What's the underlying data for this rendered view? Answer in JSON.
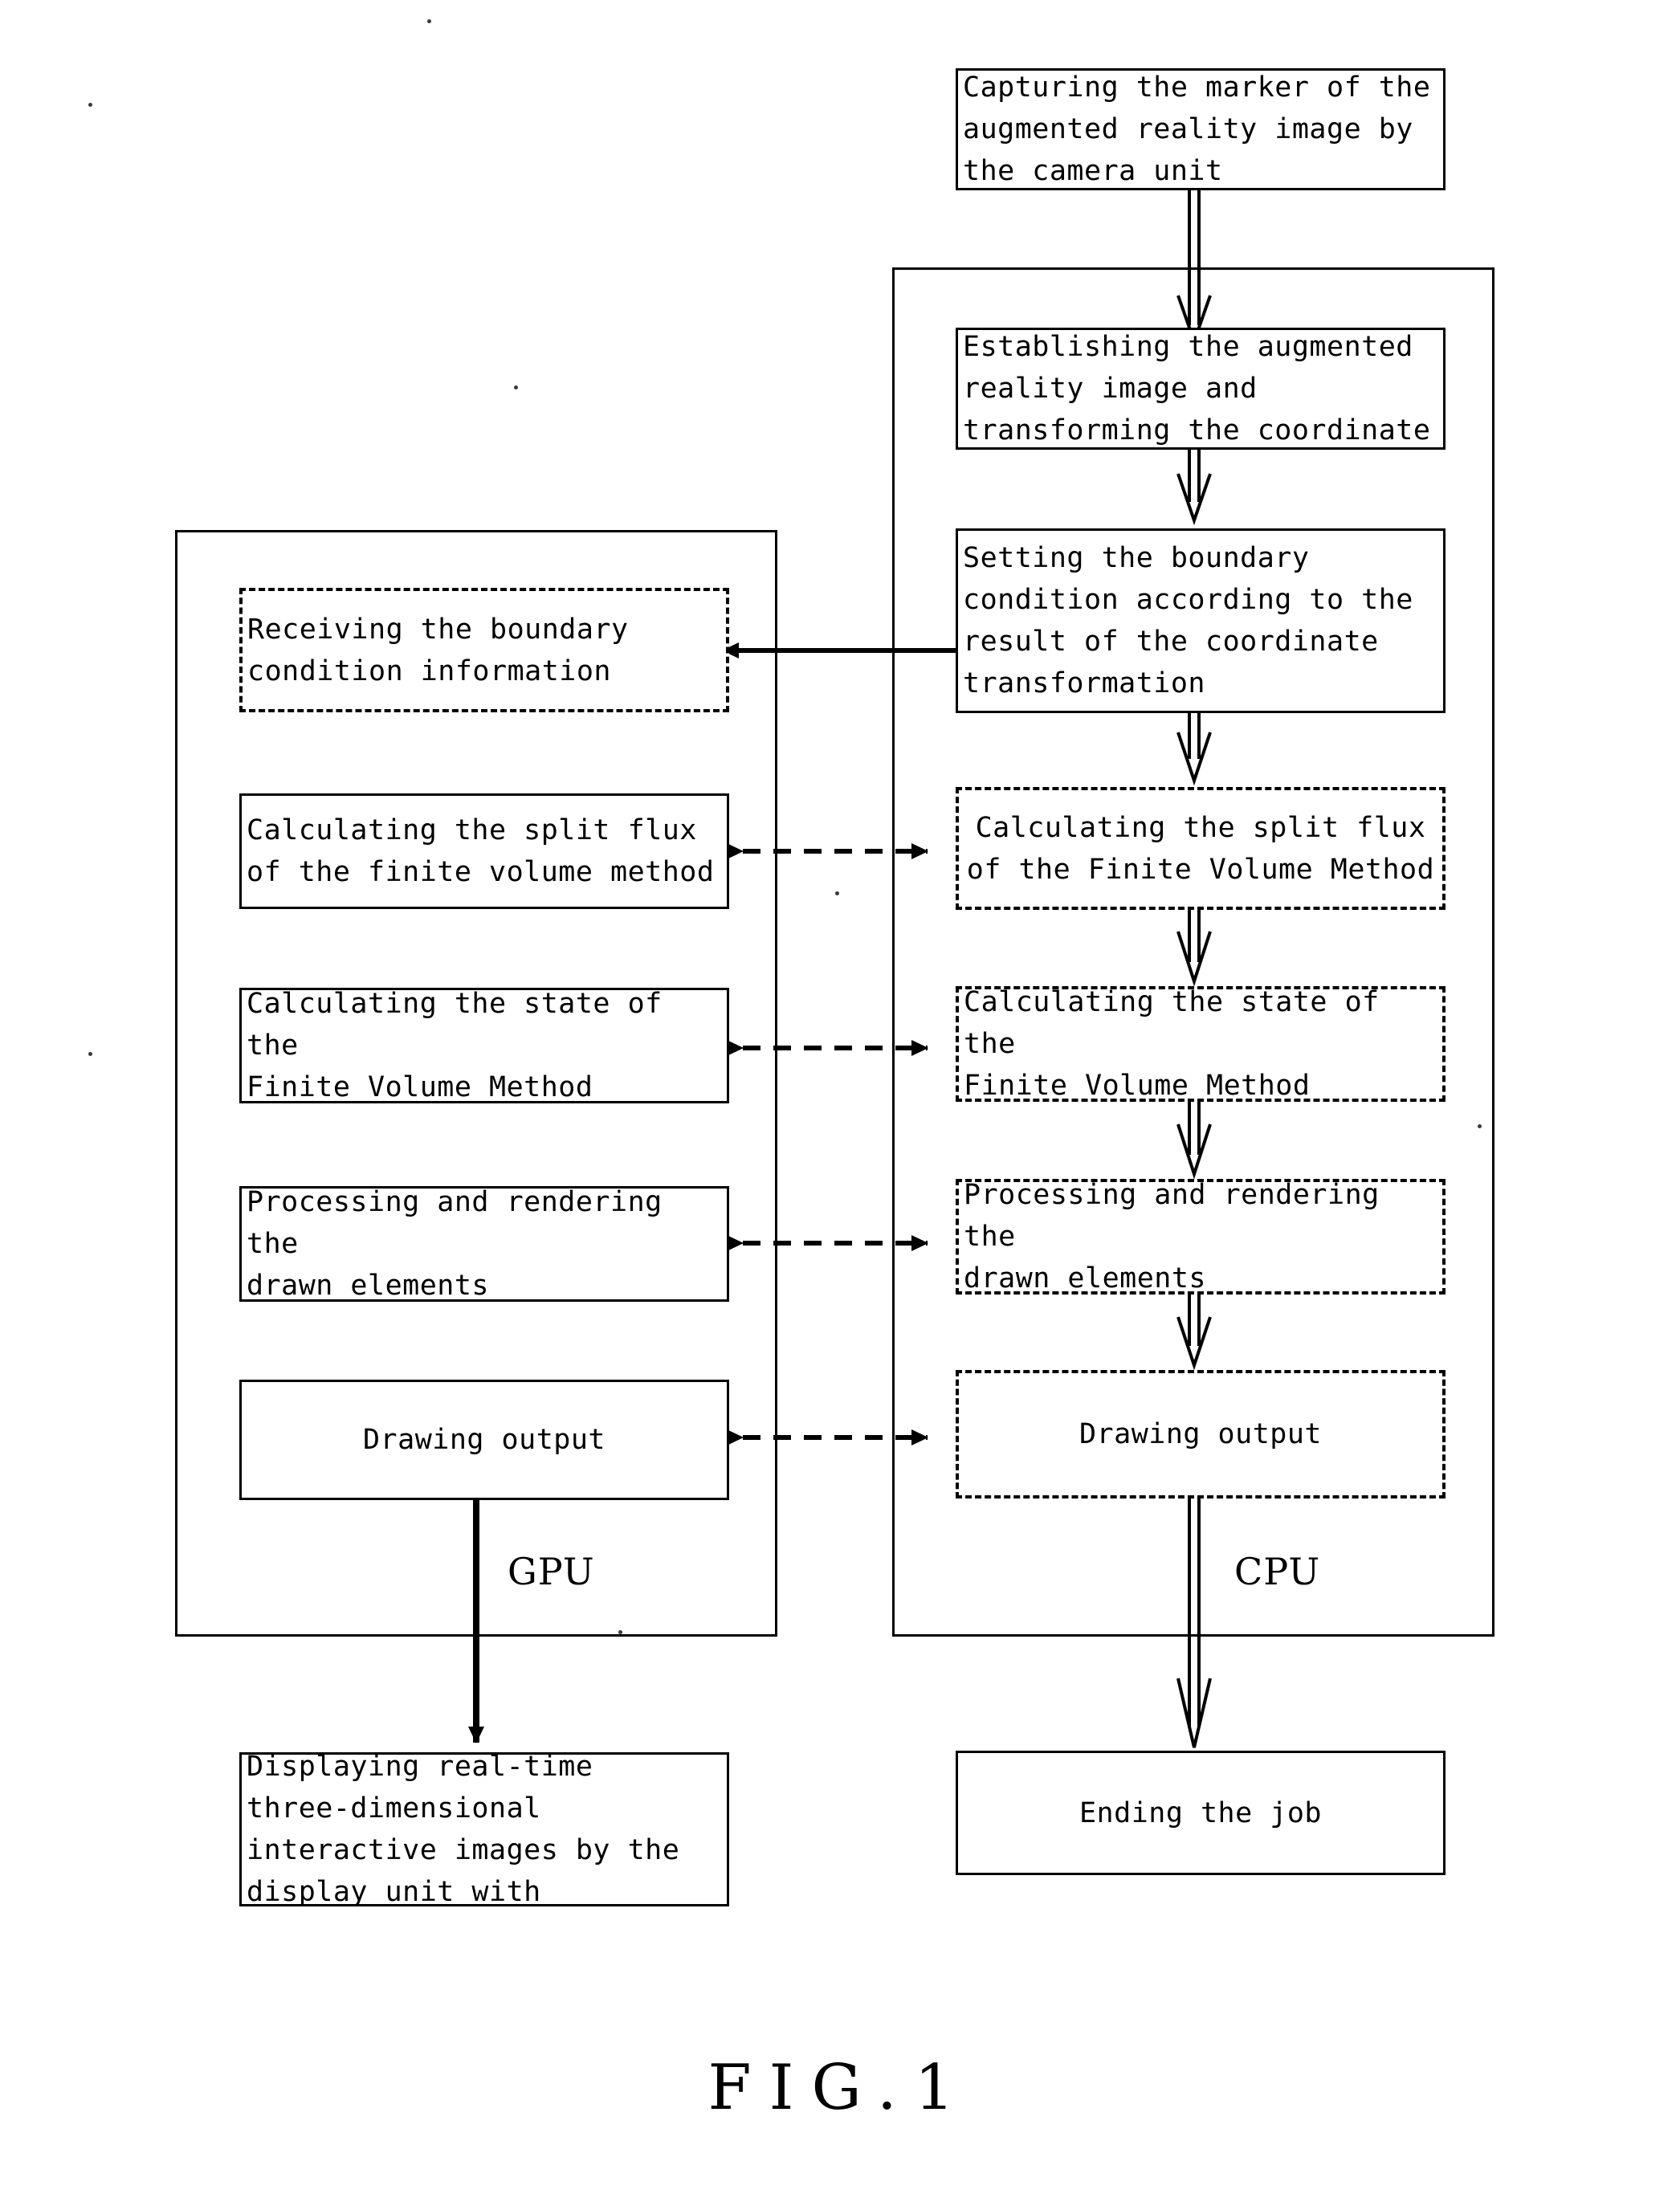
{
  "figure": {
    "caption": "FIG.1"
  },
  "groups": [
    {
      "id": "gpu",
      "label": "GPU"
    },
    {
      "id": "cpu",
      "label": "CPU"
    }
  ],
  "nodes": {
    "capture": "Capturing the marker of the\naugmented reality image by\nthe camera unit",
    "establish": "Establishing the augmented\nreality image and\ntransforming the coordinate",
    "set_boundary": "Setting the boundary\ncondition according to the\nresult of the coordinate\ntransformation",
    "cpu_split_flux": "Calculating the split flux\nof the Finite Volume Method",
    "cpu_state": "Calculating the state of the\nFinite Volume Method",
    "cpu_render": "Processing and rendering the\ndrawn elements",
    "cpu_draw_output": "Drawing output",
    "cpu_end": "Ending the job",
    "gpu_receive": "Receiving the boundary\ncondition information",
    "gpu_split_flux": "Calculating the split flux\nof the finite volume method",
    "gpu_state": "Calculating the state of the\nFinite Volume Method",
    "gpu_render": "Processing and rendering the\ndrawn elements",
    "gpu_draw_output": "Drawing output",
    "gpu_display": "Displaying real-time\nthree-dimensional\ninteractive images by the\ndisplay unit with"
  },
  "colors": {
    "stroke": "#000000",
    "background": "#ffffff"
  }
}
